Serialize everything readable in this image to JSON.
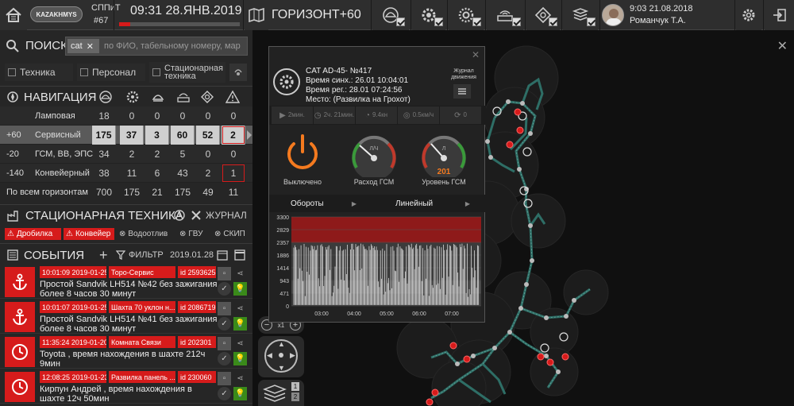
{
  "header": {
    "logo": "KAZAKHMYS",
    "tab_short": "СППиТ",
    "tab_num": "#67",
    "datetime": "09:31 28.ЯНВ.2019",
    "horizon": "ГОРИЗОНТ+60",
    "user_time": "9:03 21.08.2018",
    "user_name": "Романчук Т.А."
  },
  "search": {
    "label": "ПОИСК",
    "chip": "cat",
    "placeholder": "по ФИО, табельному номеру, мар",
    "filters": [
      "Техника",
      "Персонал",
      "Стационарная техника"
    ]
  },
  "navigation": {
    "title": "НАВИГАЦИЯ",
    "rows": [
      {
        "level": "",
        "name": "Ламповая",
        "values": [
          "18",
          "0",
          "0",
          "0",
          "0",
          "0"
        ],
        "highlight": false
      },
      {
        "level": "+60",
        "name": "Сервисный",
        "values": [
          "175",
          "37",
          "3",
          "60",
          "52",
          "2"
        ],
        "highlight": true
      },
      {
        "level": "-20",
        "name": "ГСМ, ВВ, ЭПС",
        "values": [
          "34",
          "2",
          "2",
          "5",
          "0",
          "0"
        ],
        "highlight": false
      },
      {
        "level": "-140",
        "name": "Конвейерный",
        "values": [
          "38",
          "11",
          "6",
          "43",
          "2",
          "1"
        ],
        "highlight": false
      }
    ],
    "total_label": "По всем горизонтам",
    "totals": [
      "700",
      "175",
      "21",
      "175",
      "49",
      "11"
    ]
  },
  "stationary": {
    "title": "СТАЦИОНАРНАЯ ТЕХНИКА",
    "journal": "ЖУРНАЛ",
    "tags_red": [
      "Дробилка",
      "Конвейер"
    ],
    "tags_gray": [
      "Водоотлив",
      "ГВУ",
      "СКИП"
    ]
  },
  "events": {
    "title": "СОБЫТИЯ",
    "filter": "ФИЛЬТР",
    "date": "2019.01.28",
    "items": [
      {
        "time": "10:01:09 2019-01-25",
        "place": "Торо-Сервис",
        "id": "id 2593625",
        "text": "Простой Sandvik LH514 №42 без зажигания более 8 часов 30 минут"
      },
      {
        "time": "10:01:07 2019-01-25",
        "place": "Шахта 70 уклон н...",
        "id": "id 2086719",
        "text": "Простой Sandvik LH514 №41 без зажигания более 8 часов 30 минут"
      },
      {
        "time": "11:35:24 2019-01-20",
        "place": "Комната Связи",
        "id": "id 202301",
        "text": "Toyota , время нахождения в шахте 212ч 9мин"
      },
      {
        "time": "12:08:25 2019-01-23",
        "place": "Развилка панель ...",
        "id": "id 230060",
        "text": "Кирпун Андрей , время нахождения в шахте 12ч 50мин"
      }
    ]
  },
  "popup": {
    "title": "CAT AD-45- №417",
    "sync": "Время синх.: 26.01 10:04:01",
    "reg": "Время рег.: 28.01 07:24:56",
    "place": "Место: (Развилка на Грохот)",
    "journal": "Журнал движения",
    "stats": [
      "2мин.",
      "2ч. 21мин.",
      "9.4кн",
      "0.5км/ч",
      "0"
    ],
    "power_label": "Выключено",
    "gauge1_label": "Расход ГСМ",
    "gauge1_unit": "Л/Ч",
    "gauge2_label": "Уровень ГСМ",
    "gauge2_unit": "Л",
    "gauge2_value": "201",
    "dropdown1": "Обороты",
    "dropdown2": "Линейный",
    "y_ticks": [
      "3300",
      "2829",
      "2357",
      "1886",
      "1414",
      "943",
      "471",
      "0"
    ],
    "x_ticks": [
      "03:00",
      "04:00",
      "05:00",
      "06:00",
      "07:00"
    ]
  },
  "map_controls": {
    "zoom": "x1",
    "layer_num1": "1",
    "layer_num2": "2"
  }
}
